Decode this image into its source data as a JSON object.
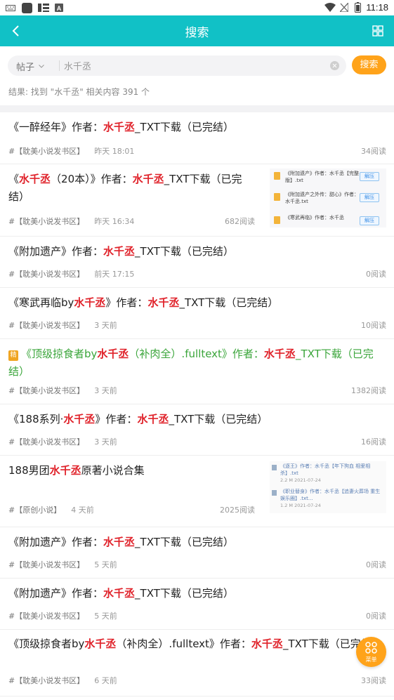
{
  "status_bar": {
    "time": "11:18"
  },
  "header": {
    "title": "搜索"
  },
  "search": {
    "type_label": "帖子",
    "query": "水千丞",
    "button_label": "搜索"
  },
  "result_summary": "结果: 找到 \"水千丞\" 相关内容 391 个",
  "posts": [
    {
      "title_parts": [
        "《一醉经年》作者：",
        "水千丞",
        "_TXT下载（已完结）"
      ],
      "category": "#【耽美小说发书区】",
      "time": "昨天 18:01",
      "reads": "34阅读"
    },
    {
      "title_parts": [
        "《",
        "水千丞",
        "（20本）》作者：",
        "水千丞",
        "_TXT下载（已完结）"
      ],
      "category": "#【耽美小说发书区】",
      "time": "昨天 16:34",
      "reads": "682阅读",
      "attachments": [
        {
          "text": "《附加遗产》作者：水千丞【完整版】.txt",
          "action": "解压"
        },
        {
          "text": "《附加遗产之外传：甜心》作者：水千丞.txt",
          "action": "解压"
        },
        {
          "text": "《寒武再临》作者：水千丞",
          "action": "解压"
        }
      ]
    },
    {
      "title_parts": [
        "《附加遗产》作者：",
        "水千丞",
        "_TXT下载（已完结）"
      ],
      "category": "#【耽美小说发书区】",
      "time": "前天 17:15",
      "reads": "0阅读"
    },
    {
      "title_parts": [
        "《寒武再临by",
        "水千丞",
        "》作者：",
        "水千丞",
        "_TXT下载（已完结）"
      ],
      "category": "#【耽美小说发书区】",
      "time": "3 天前",
      "reads": "10阅读"
    },
    {
      "badge": "精",
      "title_parts": [
        "《顶级掠食者by",
        "水千丞",
        "（补肉全）.fulltext》作者：",
        "水千丞",
        "_TXT下载（已完结）"
      ],
      "category": "#【耽美小说发书区】",
      "time": "3 天前",
      "reads": "1382阅读"
    },
    {
      "title_parts": [
        "《188系列·",
        "水千丞",
        "》作者：",
        "水千丞",
        "_TXT下载（已完结）"
      ],
      "category": "#【耽美小说发书区】",
      "time": "3 天前",
      "reads": "16阅读"
    },
    {
      "title_parts": [
        "188男团",
        "水千丞",
        "原著小说合集"
      ],
      "category": "#【原创小说】",
      "time": "4 天前",
      "reads": "2025阅读",
      "files": [
        {
          "title": "《逐王》作者：水千丞【年下狗血 相爱相杀】.txt",
          "info": "2.2 M    2021-07-24"
        },
        {
          "title": "《职业替身》作者：水千丞【追妻火葬场 重生 娱乐圈】.txt...",
          "info": "1.2 M    2021-07-24"
        }
      ]
    },
    {
      "title_parts": [
        "《附加遗产》作者：",
        "水千丞",
        "_TXT下载（已完结）"
      ],
      "category": "#【耽美小说发书区】",
      "time": "5 天前",
      "reads": "0阅读"
    },
    {
      "title_parts": [
        "《附加遗产》作者：",
        "水千丞",
        "_TXT下载（已完结）"
      ],
      "category": "#【耽美小说发书区】",
      "time": "5 天前",
      "reads": "0阅读"
    },
    {
      "title_parts": [
        "《顶级掠食者by",
        "水千丞",
        "（补肉全）.fulltext》作者：",
        "水千丞",
        "_TXT下载（已完结）"
      ],
      "category": "#【耽美小说发书区】",
      "time": "6 天前",
      "reads": "33阅读"
    }
  ],
  "fab": {
    "label": "菜单"
  },
  "colors": {
    "header": "#11c1c6",
    "accent": "#ffa31a",
    "highlight": "#e0232b",
    "elite_title": "#3aa53a"
  },
  "icons": {
    "back": "back-arrow-icon",
    "grid": "grid-icon",
    "clear": "clear-icon",
    "chevron": "chevron-down-icon",
    "fab": "menu-grid-icon"
  }
}
